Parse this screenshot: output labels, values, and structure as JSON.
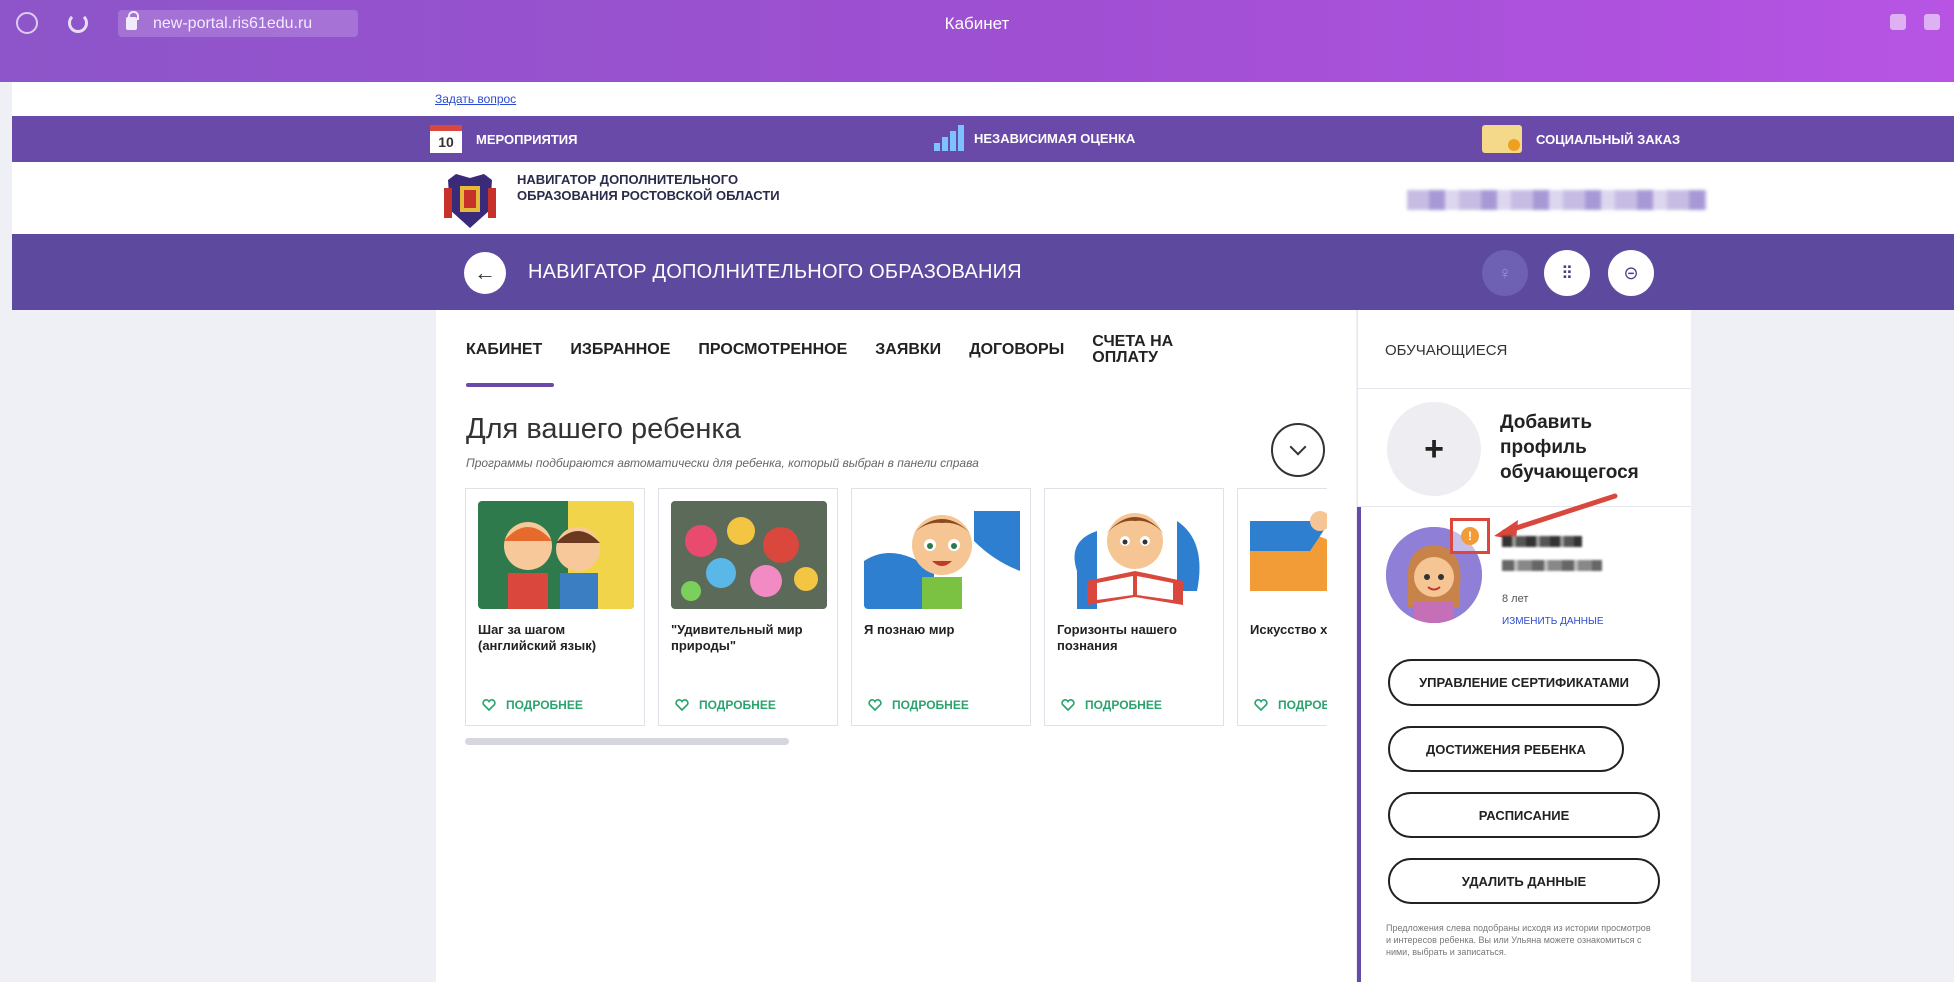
{
  "browser": {
    "url": "new-portal.ris61edu.ru",
    "window_title": "Кабинет"
  },
  "top_link": "Задать вопрос",
  "portal_nav": {
    "calendar_day": "10",
    "items": [
      {
        "label": "Мероприятия",
        "icon": "calendar-icon"
      },
      {
        "label": "Независимая оценка",
        "icon": "chart-icon"
      },
      {
        "label": "Социальный заказ",
        "icon": "document-icon"
      }
    ]
  },
  "region": {
    "title": "Навигатор дополнительного образования Ростовской области"
  },
  "navigator": {
    "title": "Навигатор дополнительного образования"
  },
  "tabs": [
    "Кабинет",
    "Избранное",
    "Просмотренное",
    "Заявки",
    "Договоры",
    "Счета на оплату"
  ],
  "recommend": {
    "title": "Для вашего ребенка",
    "subtitle": "Программы подбираются автоматически для ребенка, который выбран в панели справа"
  },
  "cards": [
    {
      "title": "Шаг за шагом (английский язык)",
      "more": "Подробнее"
    },
    {
      "title": "\"Удивительный мир природы\"",
      "more": "Подробнее"
    },
    {
      "title": "Я познаю мир",
      "more": "Подробнее"
    },
    {
      "title": "Горизонты нашего познания",
      "more": "Подробнее"
    },
    {
      "title": "Искусство хореографии",
      "more": "Подробнее"
    }
  ],
  "students_panel": {
    "title": "Обучающиеся",
    "add_profile": "Добавить профиль обучающегося",
    "child_age": "8 лет",
    "edit_label": "Изменить данные",
    "buttons": [
      "Управление сертификатами",
      "Достижения ребенка",
      "Расписание",
      "Удалить данные"
    ],
    "note": "Предложения слева подобраны исходя из истории просмотров и интересов ребенка. Вы или Ульяна можете ознакомиться с ними, выбрать и записаться."
  },
  "colors": {
    "brand_purple": "#5d4a9e",
    "nav_purple": "#6a4aa8",
    "accent_green": "#2aa36d",
    "highlight_red": "#d9473d"
  }
}
